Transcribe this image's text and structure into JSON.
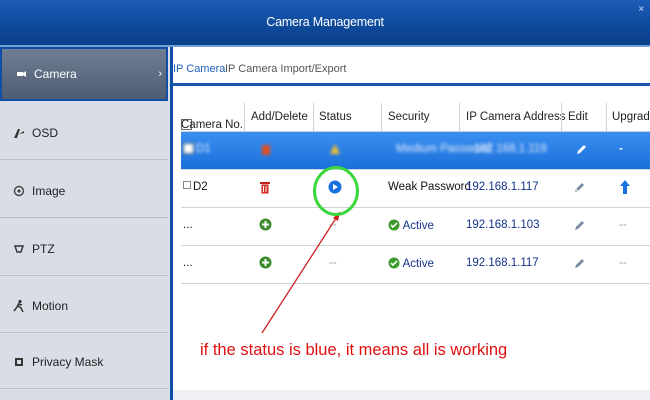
{
  "window": {
    "title": "Camera Management",
    "corner_mark": "×"
  },
  "sidebar": {
    "items": [
      {
        "label": "Camera",
        "icon": "camera-icon",
        "active": true,
        "chevron": "›"
      },
      {
        "label": "OSD",
        "icon": "osd-icon"
      },
      {
        "label": "Image",
        "icon": "image-icon"
      },
      {
        "label": "PTZ",
        "icon": "ptz-icon"
      },
      {
        "label": "Motion",
        "icon": "motion-icon"
      },
      {
        "label": "Privacy Mask",
        "icon": "privacy-mask-icon"
      }
    ]
  },
  "tabs": [
    {
      "label": "IP Camera",
      "active": true
    },
    {
      "label": "IP Camera Import/Export",
      "active": false
    }
  ],
  "table": {
    "headers": [
      "Camera No.",
      "Add/Delete",
      "Status",
      "Security",
      "IP Camera Address",
      "Edit",
      "Upgrade"
    ],
    "rows": [
      {
        "camera_no": "D1",
        "security": "Medium Password",
        "ip": "192.168.1.119",
        "upgrade": "-",
        "status_icon": "warning-icon",
        "selected": true
      },
      {
        "camera_no": "D2",
        "security": "Weak Password",
        "ip": "192.168.1.117",
        "status_icon": "play-icon",
        "upgrade_icon": "upgrade-arrow-icon"
      },
      {
        "camera_no": "...",
        "security": "Active",
        "ip": "192.168.1.103",
        "status": "--",
        "upgrade": "--"
      },
      {
        "camera_no": "...",
        "security": "Active",
        "ip": "192.168.1.117",
        "status": "--",
        "upgrade": "--"
      }
    ]
  },
  "annotation": {
    "text": "if the status is blue, it means all is working",
    "color": "#e01010",
    "circle_color": "#3bd63b"
  },
  "colors": {
    "accent": "#1b59b0",
    "selected_row": "#1b6fda"
  }
}
